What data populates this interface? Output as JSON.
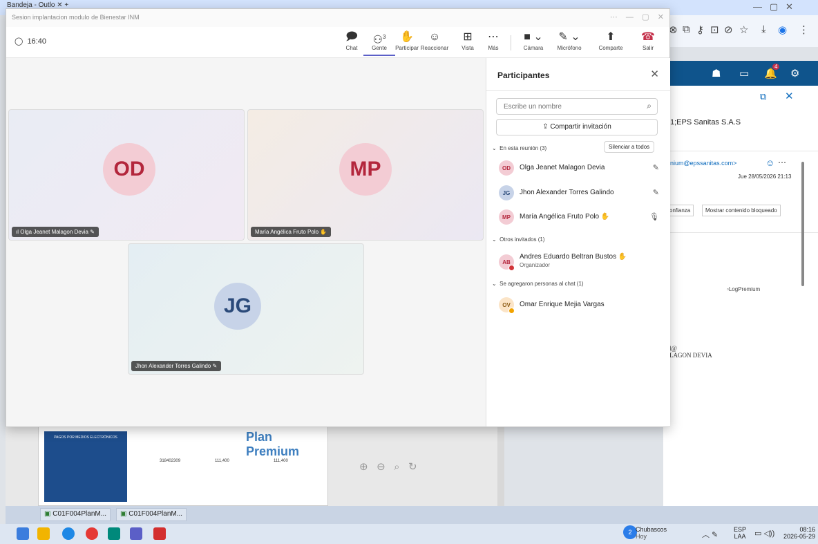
{
  "browser": {
    "tab_title": "Bandeja - Outlo",
    "outlook_recipient_heading": "1;EPS Sanitas S.A.S",
    "sender_email": "nium@epssanitas.com>",
    "message_date": "Jue 28/05/2026 21:13",
    "trust_button": "confianza",
    "show_blocked_button": "Mostrar contenido bloqueado",
    "logo_alt": "LogPremium",
    "signature_line1": "l@",
    "signature_line2": "LAGON DEVIA",
    "notification_count": "4"
  },
  "teams": {
    "window_title": "Sesion implantacion modulo de Bienestar INM",
    "timer": "16:40",
    "toolbar": {
      "chat": "Chat",
      "people": "Gente",
      "people_count": "3",
      "raise": "Participar",
      "react": "Reaccionar",
      "view": "Vista",
      "more": "Más",
      "camera": "Cámara",
      "mic": "Micrófono",
      "share": "Comparte",
      "leave": "Salir"
    },
    "tiles": [
      {
        "initials": "OD",
        "name": "Olga Jeanet Malagon Devia"
      },
      {
        "initials": "MP",
        "name": "María Angélica Fruto Polo"
      },
      {
        "initials": "JG",
        "name": "Jhon Alexander Torres Galindo"
      }
    ],
    "panel": {
      "title": "Participantes",
      "search_placeholder": "Escribe un nombre",
      "share_invite": "Compartir invitación",
      "section_in_meeting": "En esta reunión (3)",
      "mute_all": "Silenciar a todos",
      "in_meeting": [
        {
          "initials": "OD",
          "name": "Olga Jeanet Malagon Devia"
        },
        {
          "initials": "JG",
          "name": "Jhon Alexander Torres Galindo"
        },
        {
          "initials": "MP",
          "name": "María Angélica Fruto Polo"
        }
      ],
      "section_others": "Otros invitados (1)",
      "others": [
        {
          "initials": "AB",
          "name": "Andres Eduardo Beltran Bustos",
          "role": "Organizador"
        }
      ],
      "section_chat": "Se agregaron personas al chat (1)",
      "chat_added": [
        {
          "initials": "OV",
          "name": "Omar Enrique Mejia Vargas"
        }
      ]
    }
  },
  "pdf": {
    "brand": "Plan Premium",
    "contract_no": "318402309",
    "amount": "111,400",
    "section": "PAGOS POR MEDIOS ELECTRÓNICOS"
  },
  "downloads": [
    "C01F004PlanM...",
    "C01F004PlanM..."
  ],
  "taskbar": {
    "weather_title": "Chubascos",
    "weather_sub": "Hoy",
    "weather_badge": "2",
    "lang_top": "ESP",
    "lang_bottom": "LAA",
    "time": "08:16",
    "date": "2026-05-29"
  },
  "colors": {
    "teams_accent": "#5b5fc7",
    "leave_red": "#c4314b",
    "outlook_blue": "#0f548c"
  }
}
